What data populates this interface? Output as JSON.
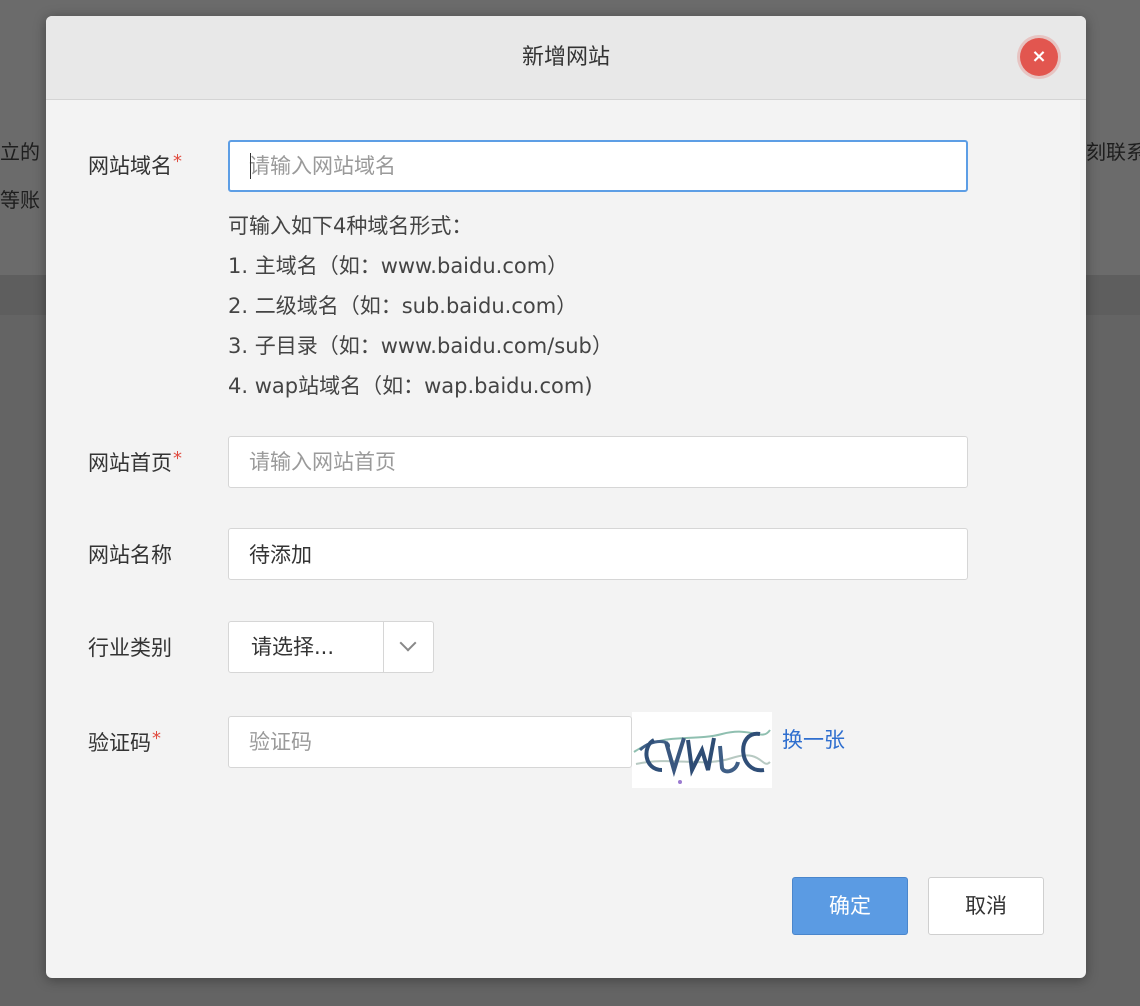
{
  "background": {
    "text_1": "立的",
    "text_2": "等账",
    "text_3": "刻联系"
  },
  "dialog": {
    "title": "新增网站",
    "close_label": "×",
    "domain": {
      "label": "网站域名",
      "required_mark": "*",
      "placeholder": "请输入网站域名",
      "value": ""
    },
    "hints": [
      "可输入如下4种域名形式：",
      "1. 主域名（如：www.baidu.com）",
      "2. 二级域名（如：sub.baidu.com）",
      "3. 子目录（如：www.baidu.com/sub）",
      "4. wap站域名（如：wap.baidu.com)"
    ],
    "homepage": {
      "label": "网站首页",
      "required_mark": "*",
      "placeholder": "请输入网站首页",
      "value": ""
    },
    "site_name": {
      "label": "网站名称",
      "value": "待添加"
    },
    "industry": {
      "label": "行业类别",
      "selected": "请选择..."
    },
    "captcha": {
      "label": "验证码",
      "required_mark": "*",
      "placeholder": "验证码",
      "value": "",
      "refresh_label": "换一张"
    },
    "confirm_label": "确定",
    "cancel_label": "取消"
  },
  "colors": {
    "primary": "#5b9be3",
    "close": "#e2564f",
    "required": "#e04b3f",
    "link": "#2f6fcf",
    "focus_border": "#5d9ee5"
  },
  "icons": {
    "close": "close-icon",
    "dropdown": "chevron-down-icon"
  }
}
